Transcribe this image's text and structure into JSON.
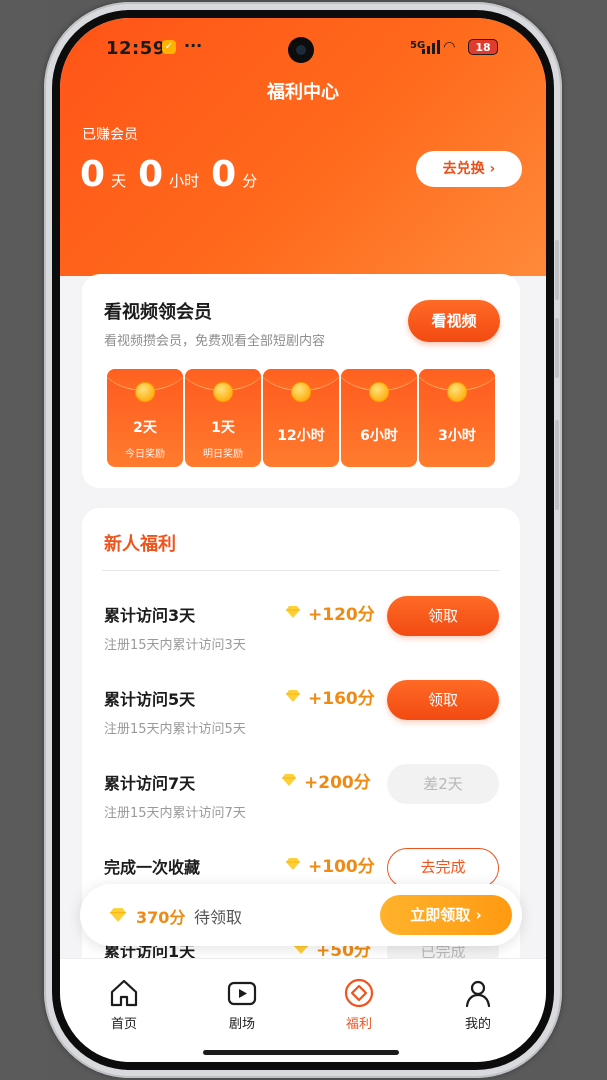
{
  "status_bar": {
    "time": "12:59",
    "network": "5G",
    "battery": "18",
    "more": "···"
  },
  "header": {
    "title": "福利中心",
    "earned_label": "已赚会员",
    "days_value": "0",
    "days_unit": "天",
    "hours_value": "0",
    "hours_unit": "小时",
    "minutes_value": "0",
    "minutes_unit": "分",
    "exchange_button": "去兑换 ›"
  },
  "video_card": {
    "title": "看视频领会员",
    "subtitle": "看视频攒会员，免费观看全部短剧内容",
    "button": "看视频",
    "rewards": [
      {
        "value": "2天",
        "note": "今日奖励"
      },
      {
        "value": "1天",
        "note": "明日奖励"
      },
      {
        "value": "12小时",
        "note": ""
      },
      {
        "value": "6小时",
        "note": ""
      },
      {
        "value": "3小时",
        "note": ""
      }
    ]
  },
  "newbie": {
    "title": "新人福利",
    "tasks": [
      {
        "name": "累计访问3天",
        "desc": "注册15天内累计访问3天",
        "points": "+120分",
        "button": "领取",
        "state": "claim"
      },
      {
        "name": "累计访问5天",
        "desc": "注册15天内累计访问5天",
        "points": "+160分",
        "button": "领取",
        "state": "claim"
      },
      {
        "name": "累计访问7天",
        "desc": "注册15天内累计访问7天",
        "points": "+200分",
        "button": "差2天",
        "state": "wait"
      },
      {
        "name": "完成一次收藏",
        "desc": "",
        "points": "+100分",
        "button": "去完成",
        "state": "todo"
      },
      {
        "name": "累计访问1天",
        "desc": "",
        "points": "+50分",
        "button": "已完成",
        "state": "wait"
      }
    ]
  },
  "pending": {
    "amount": "370分",
    "text": "待领取",
    "button": "立即领取 ›"
  },
  "tabbar": {
    "items": [
      {
        "label": "首页",
        "icon": "home-icon"
      },
      {
        "label": "剧场",
        "icon": "play-icon"
      },
      {
        "label": "福利",
        "icon": "gift-diamond-icon"
      },
      {
        "label": "我的",
        "icon": "profile-icon"
      }
    ],
    "active_index": 2
  },
  "colors": {
    "accent": "#f0541d",
    "points": "#f08a12",
    "claim_bar": "#ffa51f"
  }
}
